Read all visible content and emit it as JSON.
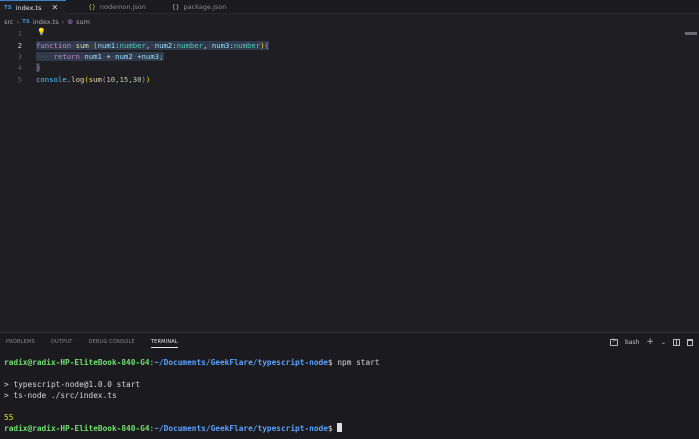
{
  "tabs": [
    {
      "badge": "TS",
      "label": "index.ts",
      "close": "✕",
      "active": true
    },
    {
      "badge": "{}",
      "label": "nodemon.json",
      "active": false
    },
    {
      "badge": "{}",
      "label": "package.json",
      "active": false
    }
  ],
  "breadcrumb": {
    "folder": "src",
    "file_badge": "TS",
    "file": "index.ts",
    "symbol": "sum"
  },
  "editor": {
    "line_numbers": [
      "1",
      "2",
      "3",
      "4",
      "5"
    ],
    "line2": {
      "kw": "function",
      "name": "sum",
      "p1": "num1",
      "t1": "number",
      "p2": "num2",
      "t2": "number",
      "p3": "num3",
      "t3": "number"
    },
    "line3": {
      "kw": "return",
      "expr_a": "num1",
      "op1": "+",
      "expr_b": "num2",
      "op2": "+",
      "expr_c": "num3"
    },
    "line5": {
      "obj": "console",
      "method": "log",
      "fn": "sum",
      "args": "10,15,30"
    }
  },
  "panel": {
    "tabs": [
      "PROBLEMS",
      "OUTPUT",
      "DEBUG CONSOLE",
      "TERMINAL"
    ],
    "shell": "bash",
    "add": "+",
    "chevron": "⌄"
  },
  "terminal": {
    "user": "radix@radix-HP-EliteBook-840-G4",
    "sep": ":",
    "path": "~/Documents/GeekFlare/typescript-node",
    "dollar": "$",
    "command": "npm start",
    "out1": "> typescript-node@1.0.0 start",
    "out2": "> ts-node ./src/index.ts",
    "result": "55"
  }
}
